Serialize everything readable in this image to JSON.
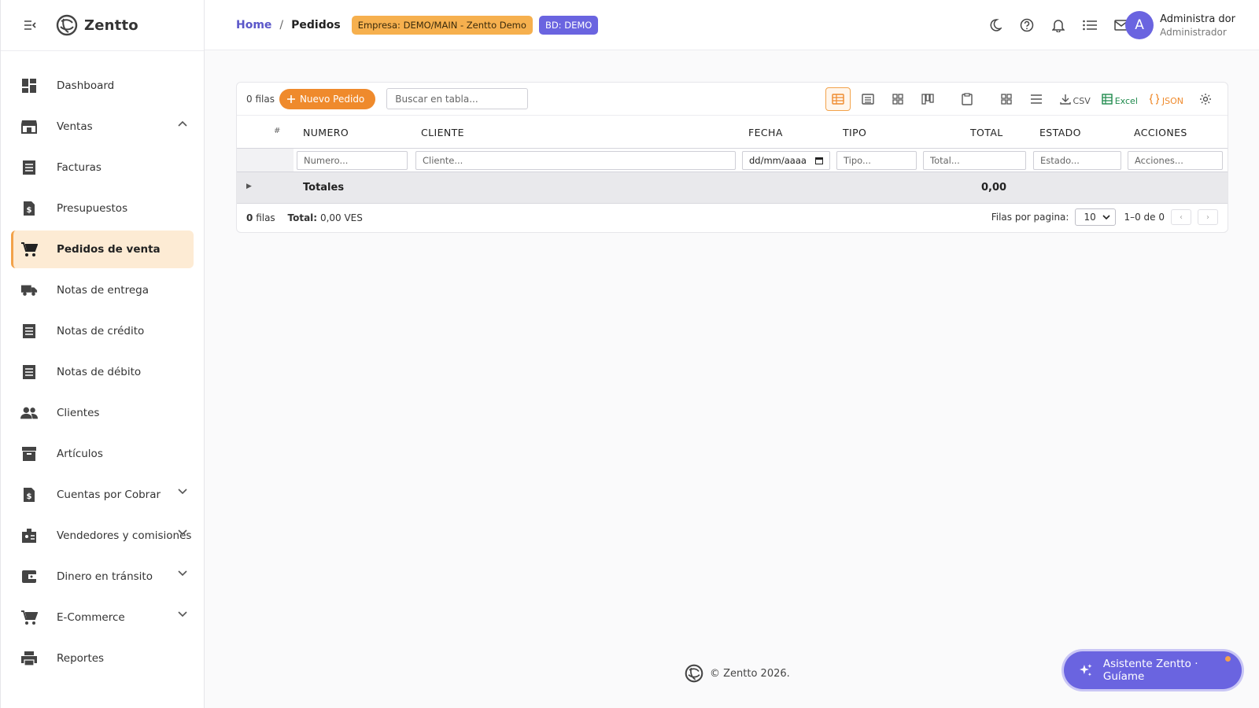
{
  "brand": {
    "name": "Zentto"
  },
  "sidebar": {
    "items": [
      {
        "label": "Dashboard",
        "icon": "dashboard-icon"
      },
      {
        "label": "Ventas",
        "icon": "store-icon",
        "chevron": "up"
      },
      {
        "label": "Facturas",
        "icon": "receipt-icon"
      },
      {
        "label": "Presupuestos",
        "icon": "dollar-file-icon"
      },
      {
        "label": "Pedidos de venta",
        "icon": "cart-icon",
        "active": true
      },
      {
        "label": "Notas de entrega",
        "icon": "truck-icon"
      },
      {
        "label": "Notas de crédito",
        "icon": "receipt-icon"
      },
      {
        "label": "Notas de débito",
        "icon": "receipt-icon"
      },
      {
        "label": "Clientes",
        "icon": "people-icon"
      },
      {
        "label": "Artículos",
        "icon": "archive-icon"
      },
      {
        "label": "Cuentas por Cobrar",
        "icon": "dollar-file-icon",
        "chevron": "down"
      },
      {
        "label": "Vendedores y comisiones",
        "icon": "badge-icon",
        "chevron": "down"
      },
      {
        "label": "Dinero en tránsito",
        "icon": "wallet-icon",
        "chevron": "down"
      },
      {
        "label": "E-Commerce",
        "icon": "cart-icon",
        "chevron": "down"
      },
      {
        "label": "Reportes",
        "icon": "printer-icon"
      }
    ]
  },
  "topbar": {
    "breadcrumb_home": "Home",
    "breadcrumb_sep": "/",
    "breadcrumb_current": "Pedidos",
    "empresa_badge": "Empresa: DEMO/MAIN - Zentto Demo",
    "bd_badge": "BD: DEMO",
    "user_initial": "A",
    "user_name": "Administra dor",
    "user_role": "Administrador"
  },
  "toolbar": {
    "rows_label": "0 filas",
    "new_button": "Nuevo Pedido",
    "search_placeholder": "Buscar en tabla...",
    "csv_label": "CSV",
    "excel_label": "Excel",
    "json_label": "JSON"
  },
  "table": {
    "columns": [
      "#",
      "NUMERO",
      "CLIENTE",
      "FECHA",
      "TIPO",
      "TOTAL",
      "ESTADO",
      "ACCIONES"
    ],
    "filters": {
      "numero": "Numero...",
      "cliente": "Cliente...",
      "fecha": "dd/mm/aaaa",
      "tipo": "Tipo...",
      "total": "Total...",
      "estado": "Estado...",
      "acciones": "Acciones..."
    },
    "totals_label": "Totales",
    "totals_value": "0,00"
  },
  "footer": {
    "rows_count": "0",
    "rows_word": "filas",
    "total_label": "Total:",
    "total_value": "0,00 VES",
    "per_page_label": "Filas por pagina:",
    "per_page_value": "10",
    "range": "1–0 de 0",
    "prev": "‹",
    "next": "›"
  },
  "page_footer": {
    "copyright": "© Zentto 2026."
  },
  "assistant": {
    "label": "Asistente Zentto · Guíame"
  },
  "colors": {
    "accent": "#ef8a2c",
    "primary": "#6a64e0",
    "active_bg": "#fdebd4"
  }
}
